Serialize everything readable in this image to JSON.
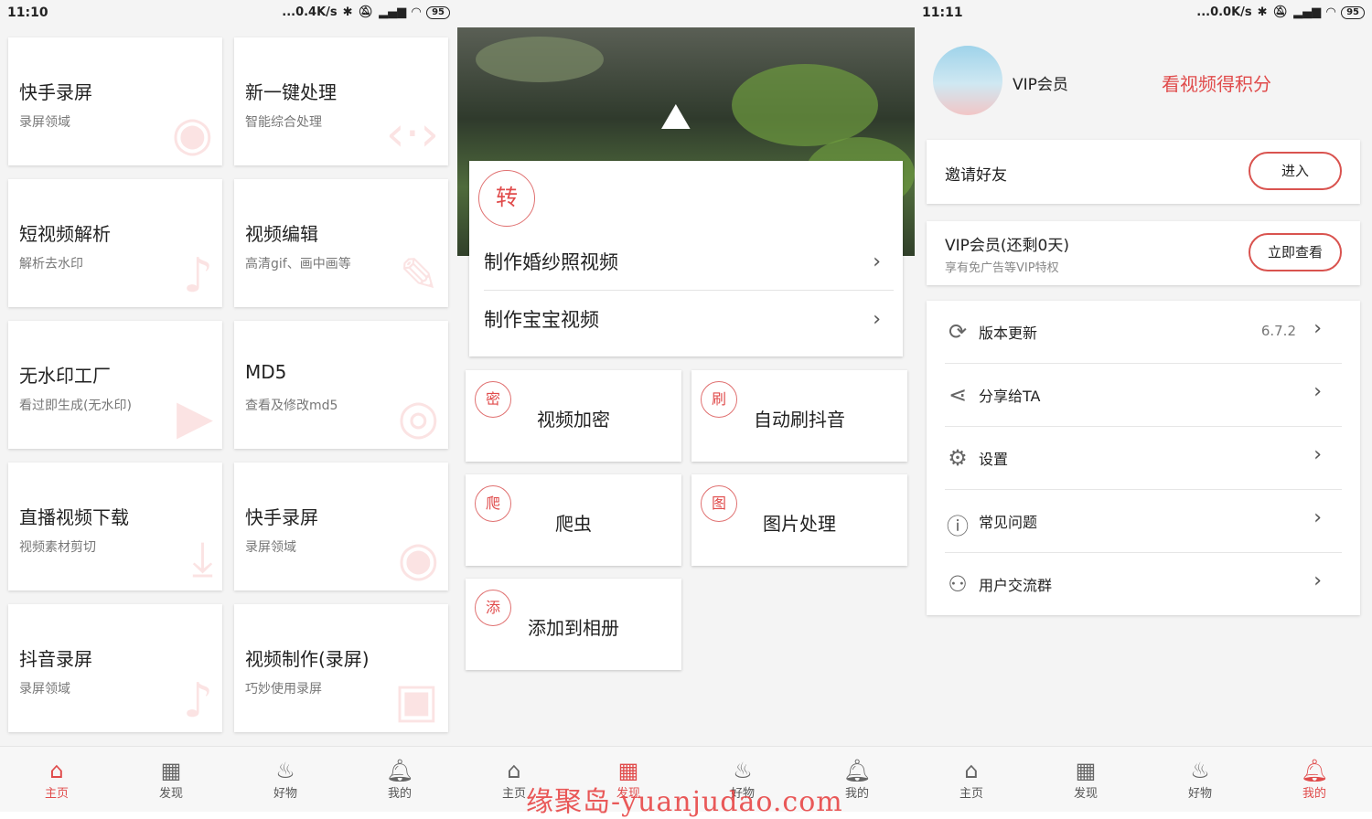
{
  "screen1": {
    "status": {
      "time": "11:10",
      "speed": "...0.4K/s",
      "battery": "95"
    },
    "cards": [
      {
        "title": "快手录屏",
        "sub": "录屏领域",
        "icon": "camera-icon"
      },
      {
        "title": "新一键处理",
        "sub": "智能综合处理",
        "icon": "code-icon"
      },
      {
        "title": "短视频解析",
        "sub": "解析去水印",
        "icon": "tiktok-icon"
      },
      {
        "title": "视频编辑",
        "sub": "高清gif、画中画等",
        "icon": "pencil-icon"
      },
      {
        "title": "无水印工厂",
        "sub": "看过即生成(无水印)",
        "icon": "play-icon"
      },
      {
        "title": "MD5",
        "sub": "查看及修改md5",
        "icon": "target-icon"
      },
      {
        "title": "直播视频下载",
        "sub": "视频素材剪切",
        "icon": "download-icon"
      },
      {
        "title": "快手录屏",
        "sub": "录屏领域",
        "icon": "camera-icon"
      },
      {
        "title": "抖音录屏",
        "sub": "录屏领域",
        "icon": "tiktok-icon"
      },
      {
        "title": "视频制作(录屏)",
        "sub": "巧妙使用录屏",
        "icon": "video-add-icon"
      }
    ]
  },
  "screen2": {
    "circle_main": "转",
    "rows": [
      {
        "label": "制作婚纱照视频"
      },
      {
        "label": "制作宝宝视频"
      }
    ],
    "tiles": [
      {
        "badge": "密",
        "label": "视频加密"
      },
      {
        "badge": "刷",
        "label": "自动刷抖音"
      },
      {
        "badge": "爬",
        "label": "爬虫"
      },
      {
        "badge": "图",
        "label": "图片处理"
      },
      {
        "badge": "添",
        "label": "添加到相册"
      }
    ]
  },
  "screen3": {
    "status": {
      "time": "11:11",
      "speed": "...0.0K/s",
      "battery": "95"
    },
    "vip_name": "VIP会员",
    "earn_link": "看视频得积分",
    "invite": {
      "label": "邀请好友",
      "button": "进入"
    },
    "vip": {
      "title": "VIP会员(还剩0天)",
      "sub": "享有免广告等VIP特权",
      "button": "立即查看"
    },
    "menu": [
      {
        "label": "版本更新",
        "value": "6.7.2",
        "icon": "refresh-icon"
      },
      {
        "label": "分享给TA",
        "value": "",
        "icon": "share-icon"
      },
      {
        "label": "设置",
        "value": "",
        "icon": "gear-icon"
      },
      {
        "label": "常见问题",
        "value": "",
        "icon": "help-icon"
      },
      {
        "label": "用户交流群",
        "value": "",
        "icon": "group-add-icon"
      }
    ]
  },
  "nav": [
    {
      "label": "主页",
      "icon": "home-icon"
    },
    {
      "label": "发现",
      "icon": "grid-icon"
    },
    {
      "label": "好物",
      "icon": "flame-icon"
    },
    {
      "label": "我的",
      "icon": "bell-icon"
    }
  ],
  "watermark": "缘聚岛-yuanjudao.com",
  "colors": {
    "accent": "#e04b4b",
    "background": "#f4f4f4"
  }
}
